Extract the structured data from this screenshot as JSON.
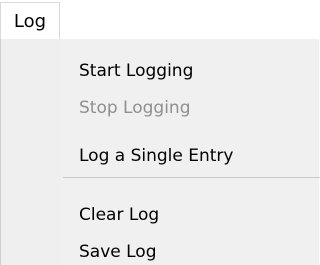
{
  "menubar": {
    "title": "Log"
  },
  "menu": {
    "items": [
      {
        "label": "Start Logging",
        "enabled": true
      },
      {
        "label": "Stop Logging",
        "enabled": false
      },
      {
        "label": "Log a Single Entry",
        "enabled": true
      },
      {
        "label": "Clear Log",
        "enabled": true
      },
      {
        "label": "Save Log",
        "enabled": true
      }
    ]
  }
}
